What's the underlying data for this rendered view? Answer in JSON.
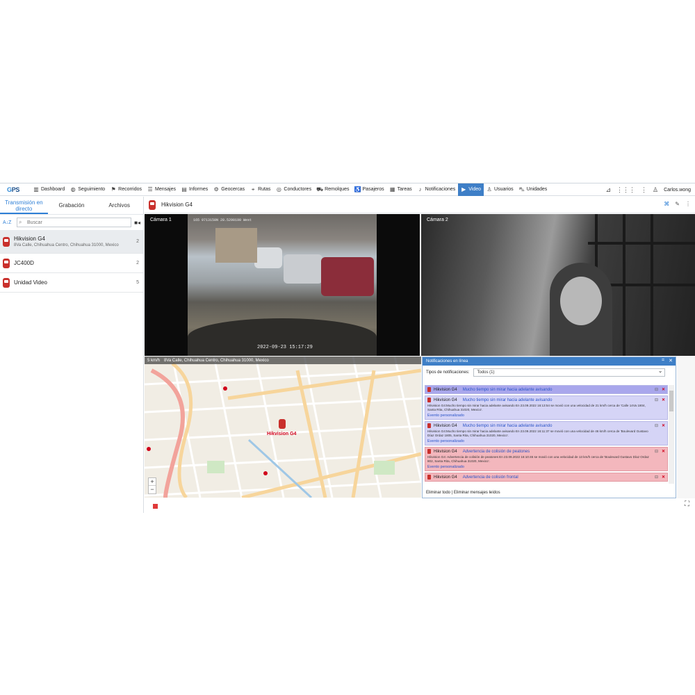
{
  "logo": {
    "text_a": "G",
    "text_b": "PS"
  },
  "nav": [
    {
      "label": "Dashboard",
      "icon": "▥"
    },
    {
      "label": "Seguimiento",
      "icon": "◍"
    },
    {
      "label": "Recorridos",
      "icon": "⚑"
    },
    {
      "label": "Mensajes",
      "icon": "☰"
    },
    {
      "label": "Informes",
      "icon": "▤"
    },
    {
      "label": "Geocercas",
      "icon": "⚙"
    },
    {
      "label": "Rutas",
      "icon": "⌖"
    },
    {
      "label": "Conductores",
      "icon": "◎"
    },
    {
      "label": "Remolques",
      "icon": "⛟"
    },
    {
      "label": "Pasajeros",
      "icon": "♿"
    },
    {
      "label": "Tareas",
      "icon": "▦"
    },
    {
      "label": "Notificaciones",
      "icon": "♪"
    },
    {
      "label": "Video",
      "icon": "▶"
    },
    {
      "label": "Usuarios",
      "icon": "♙"
    },
    {
      "label": "Unidades",
      "icon": "⛍"
    }
  ],
  "nav_right": {
    "user": "Carlos.wong"
  },
  "left": {
    "tabs": [
      "Transmisión en directo",
      "Grabación",
      "Archivos"
    ],
    "sort_label": "A↓Z",
    "search_placeholder": "Buscar",
    "units": [
      {
        "name": "Hikvision G4",
        "address": "8Va Calle, Chihuahua Centro, Chihuahua 31000, Mexico",
        "count": "2"
      },
      {
        "name": "JC400D",
        "address": "",
        "count": "2"
      },
      {
        "name": "Unidad Video",
        "address": "",
        "count": "5"
      }
    ]
  },
  "main": {
    "title": "Hikvision G4",
    "cam1_label": "Cámara 1",
    "cam2_label": "Cámara 2",
    "cam1_timestamp": "2022-09-23 15:17:29",
    "cam1_header": "165  9713150N 28.5290190  West",
    "map_speed": "5 km/h",
    "map_address": "8Va Calle, Chihuahua Centro, Chihuahua 31000, Mexico",
    "map_marker_label": "Hikvision G4",
    "zoom_in": "+",
    "zoom_out": "−"
  },
  "notifications": {
    "title": "Notificaciones en línea",
    "filter_label": "Tipos de notificaciones:",
    "filter_value": "Todos (1)",
    "items": [
      {
        "unit": "Hikvision G4",
        "title": "Mucho tiempo sin mirar hacia adelante avisando",
        "body": "",
        "event": "",
        "style": "blue hl"
      },
      {
        "unit": "Hikvision G4",
        "title": "Mucho tiempo sin mirar hacia adelante avisando",
        "body": "Hikvision G4:Mucho tiempo sin mirar hacia adelante avisando En 23.09.2022 16:13:54 se movió con una velocidad de 21 km/h cerca de 'Calle 14Va 1804, Santa Rita, Chihuahua 31020, Mexico'.",
        "event": "Evento personalizado",
        "style": "blue"
      },
      {
        "unit": "Hikvision G4",
        "title": "Mucho tiempo sin mirar hacia adelante avisando",
        "body": "Hikvision G4:Mucho tiempo sin mirar hacia adelante avisando En 23.09.2022 16:11:37 se movió con una velocidad de 46 km/h cerca de 'Boulevard Gustavo Díaz Ordaz 1805, Santa Rita, Chihuahua 31020, Mexico'.",
        "event": "Evento personalizado",
        "style": "blue"
      },
      {
        "unit": "Hikvision G4",
        "title": "Advertencia de colisión de peatones",
        "body": "Hikvision G4: Advertencia de colisión de peatones En 23.09.2022 16:10:46 se movió con una velocidad de 13 km/h cerca de 'Boulevard Gustavo Díaz Ordaz 802, Santa Rita, Chihuahua 31020, Mexico'.",
        "event": "Evento personalizado",
        "style": "red"
      },
      {
        "unit": "Hikvision G4",
        "title": "Advertencia de colisión frontal",
        "body": "",
        "event": "",
        "style": "red"
      }
    ],
    "footer": "Eliminar todo | Eliminar mensajes leídos"
  },
  "colors": {
    "accent": "#3e7fc7",
    "alert_red": "#c9302c"
  }
}
